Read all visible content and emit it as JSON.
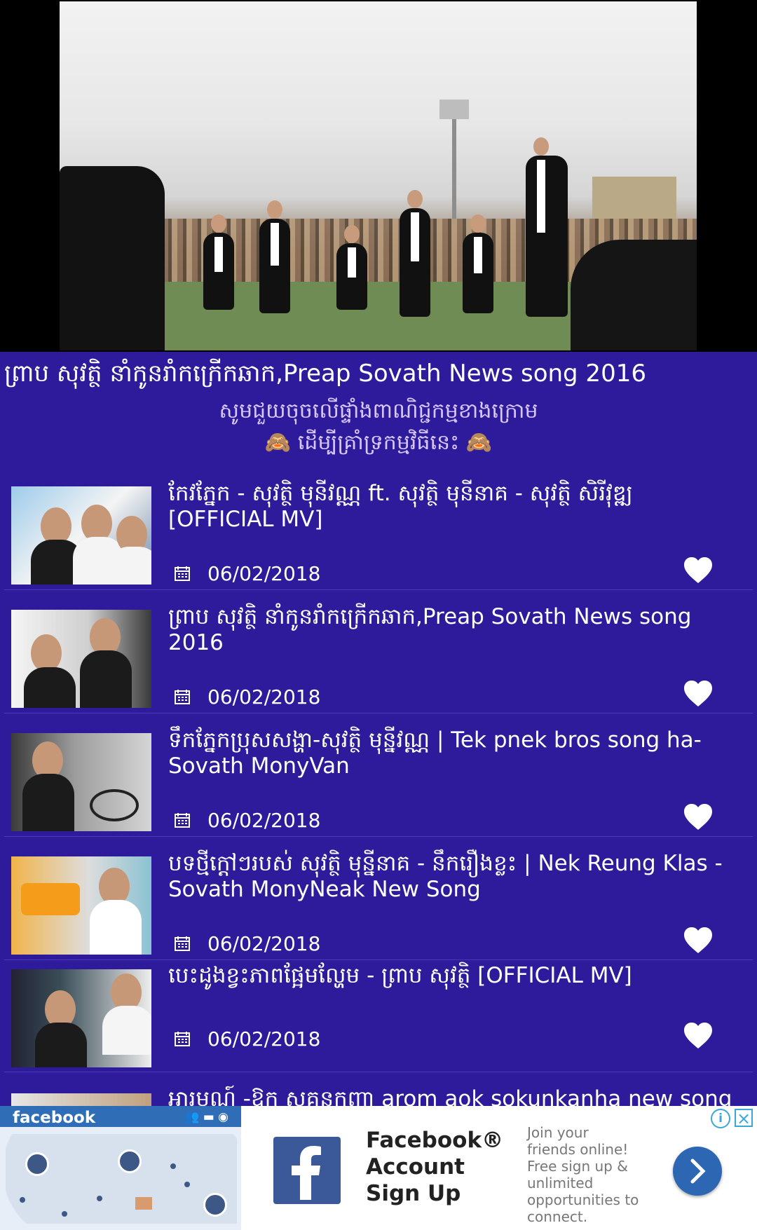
{
  "player": {
    "title": "ព្រាប សុវត្ថិ នាំកូនរាំកក្រើកឆាក,Preap Sovath News song 2016"
  },
  "notice": {
    "line1": "សូមជួយចុចលើផ្ទាំងពាណិជ្ជកម្មខាងក្រោម",
    "line2": "🙈 ដើម្បីគ្រាំទ្រកម្មវិធីនេះ 🙈"
  },
  "playlist": [
    {
      "title": "កែវភ្នែក - សុវត្ថិ មុនីវណ្ណ ft. សុវត្ថិ មុនីនាគ - សុវត្ថិ សិរីវុឌ្ឍ [OFFICIAL MV]",
      "date": "06/02/2018"
    },
    {
      "title": "ព្រាប សុវត្ថិ នាំកូនរាំកក្រើកឆាក,Preap Sovath News song 2016",
      "date": "06/02/2018"
    },
    {
      "title": "ទឹកភ្នែកប្រុសសង្ហា-សុវត្ថិ មុន្នីវណ្ណ | Tek pnek bros song ha-Sovath MonyVan",
      "date": "06/02/2018"
    },
    {
      "title": "បទថ្មីក្តៅៗរបស់ សុវត្ថិ មុន្នីនាគ - នឹករឿងខ្លះ | Nek Reung Klas - Sovath MonyNeak New Song",
      "date": "06/02/2018"
    },
    {
      "title": "បេះដូងខ្វះភាពផ្អែមល្ហែម - ព្រាប សុវត្ថិ [OFFICIAL MV]",
      "date": "06/02/2018"
    },
    {
      "title": "អារម្មណ៍ -ឱក សុគន្ធកញ្ញា arom aok sokunkanha new song",
      "date": ""
    }
  ],
  "ad": {
    "brand": "facebook",
    "title": "Facebook® Account Sign Up",
    "description": "Join your friends online! Free sign up & unlimited opportunities to connect.",
    "info": "i",
    "close": "×"
  }
}
